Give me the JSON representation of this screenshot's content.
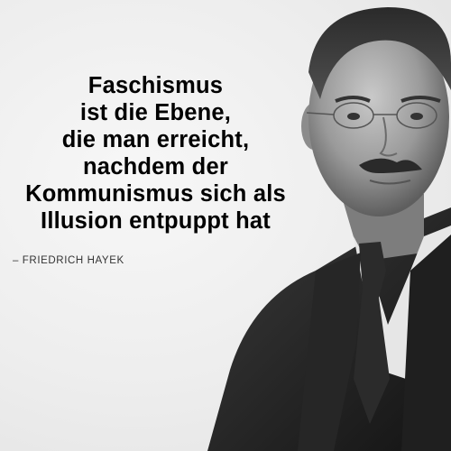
{
  "quote": {
    "lines": [
      "Faschismus",
      "ist die Ebene,",
      "die man erreicht,",
      "nachdem der",
      "Kommunismus sich als",
      "Illusion entpuppt hat"
    ]
  },
  "author": "– FRIEDRICH HAYEK",
  "colors": {
    "background": "#efefef",
    "text": "#000000",
    "author_text": "#333333"
  }
}
